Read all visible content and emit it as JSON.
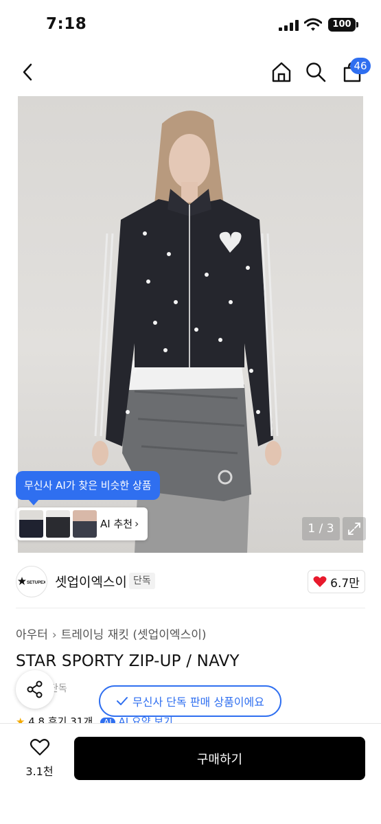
{
  "status_bar": {
    "time": "7:18",
    "battery": "100"
  },
  "nav": {
    "cart_count": "46"
  },
  "gallery": {
    "ai_tooltip": "무신사 AI가 찾은 비슷한 상품",
    "ai_recommend_label": "AI 추천",
    "counter": "1 / 3"
  },
  "brand": {
    "logo_text": "SETUPEXE",
    "name": "셋업이엑스이",
    "badge": "단독",
    "like_count": "6.7만"
  },
  "breadcrumb": {
    "category": "아우터",
    "subcategory": "트레이닝 재킷 (셋업이엑스이)"
  },
  "product": {
    "title": "STAR SPORTY ZIP-UP / NAVY",
    "badge": "단독",
    "exclusive_notice": "무신사 단독 판매 상품이에요",
    "rating": "4.8",
    "reviews": "후기 31개",
    "ai_chip": "AI",
    "ai_summary": "AI 요약 보기"
  },
  "bottom_bar": {
    "wish_count": "3.1천",
    "buy_label": "구매하기"
  },
  "colors": {
    "accent": "#2f6ff0",
    "heart": "#e8192c",
    "star": "#f2a800",
    "buy": "#000000"
  }
}
